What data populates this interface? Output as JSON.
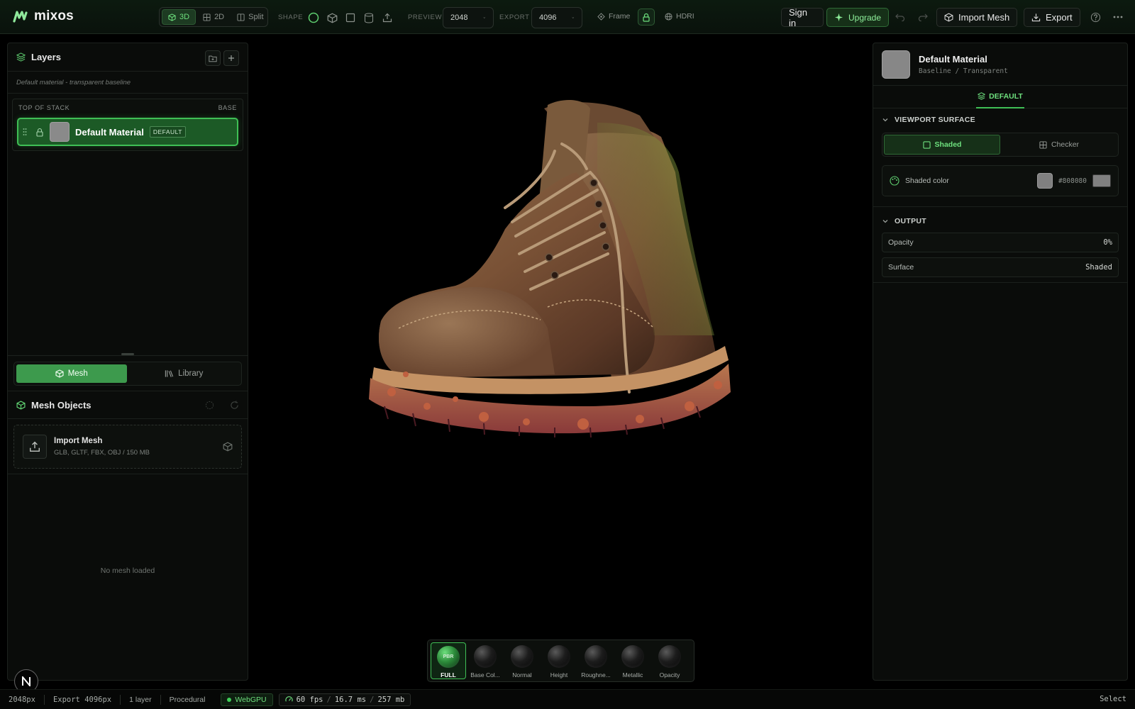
{
  "app": {
    "name": "mixos"
  },
  "topbar": {
    "view_modes": [
      {
        "label": "3D",
        "active": true
      },
      {
        "label": "2D",
        "active": false
      },
      {
        "label": "Split",
        "active": false
      }
    ],
    "shape_label": "SHAPE",
    "preview_label": "PREVIEW",
    "preview_value": "2048",
    "export_label": "EXPORT",
    "export_value": "4096",
    "frame_label": "Frame",
    "hdri_label": "HDRI",
    "sign_in": "Sign in",
    "upgrade": "Upgrade",
    "import_mesh": "Import Mesh",
    "export": "Export"
  },
  "layers": {
    "title": "Layers",
    "subtitle": "Default material - transparent baseline",
    "stack_top": "TOP OF STACK",
    "stack_base": "BASE",
    "items": [
      {
        "name": "Default Material",
        "badge": "DEFAULT"
      }
    ]
  },
  "left_modes": [
    {
      "label": "Mesh",
      "active": true
    },
    {
      "label": "Library",
      "active": false
    }
  ],
  "mesh_objects": {
    "title": "Mesh Objects",
    "import_title": "Import Mesh",
    "import_sub": "GLB, GLTF, FBX, OBJ / 150 MB",
    "empty": "No mesh loaded"
  },
  "channels": [
    {
      "label": "FULL",
      "sphere_text": "PBR",
      "active": true
    },
    {
      "label": "Base Col...",
      "active": false
    },
    {
      "label": "Normal",
      "active": false
    },
    {
      "label": "Height",
      "active": false
    },
    {
      "label": "Roughne...",
      "active": false
    },
    {
      "label": "Metallic",
      "active": false
    },
    {
      "label": "Opacity",
      "active": false
    }
  ],
  "material": {
    "title": "Default Material",
    "subtitle": "Baseline / Transparent",
    "tab": "DEFAULT",
    "viewport_surface_label": "VIEWPORT SURFACE",
    "surface_options": [
      {
        "label": "Shaded",
        "active": true
      },
      {
        "label": "Checker",
        "active": false
      }
    ],
    "shaded_color_label": "Shaded color",
    "shaded_color_hex": "#808080",
    "output_label": "OUTPUT",
    "properties": [
      {
        "label": "Opacity",
        "value": "0%"
      },
      {
        "label": "Surface",
        "value": "Shaded"
      }
    ]
  },
  "status": {
    "preview": "2048px",
    "export": "Export 4096px",
    "layers": "1 layer",
    "mode": "Procedural",
    "gpu": "WebGPU",
    "fps": "60 fps",
    "ms": "16.7 ms",
    "mem": "257 mb",
    "tool": "Select"
  },
  "colors": {
    "accent": "#3fbf55",
    "accent_text": "#6ee07e",
    "panel": "#0a0c0a",
    "shaded": "#808080"
  }
}
